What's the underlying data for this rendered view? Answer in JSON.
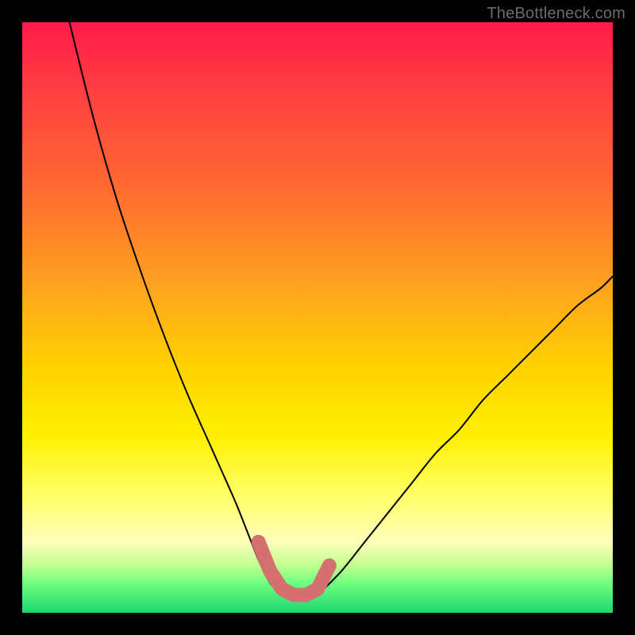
{
  "watermark": "TheBottleneck.com",
  "colors": {
    "curve": "#000000",
    "marker": "#d47070",
    "frame": "#000000"
  },
  "chart_data": {
    "type": "line",
    "title": "",
    "xlabel": "",
    "ylabel": "",
    "xlim": [
      0,
      100
    ],
    "ylim": [
      0,
      100
    ],
    "grid": false,
    "legend": false,
    "series": [
      {
        "name": "left-curve",
        "x": [
          8,
          12,
          16,
          20,
          24,
          28,
          32,
          36,
          38,
          40,
          42,
          44
        ],
        "y": [
          100,
          84,
          70,
          58,
          47,
          37,
          28,
          19,
          14,
          9,
          5,
          3
        ]
      },
      {
        "name": "right-curve",
        "x": [
          50,
          54,
          58,
          62,
          66,
          70,
          74,
          78,
          82,
          86,
          90,
          94,
          98,
          100
        ],
        "y": [
          3,
          7,
          12,
          17,
          22,
          27,
          31,
          36,
          40,
          44,
          48,
          52,
          55,
          57
        ]
      },
      {
        "name": "valley-marker",
        "x": [
          40,
          42,
          44,
          46,
          48,
          50,
          52
        ],
        "y": [
          12,
          7,
          4,
          3,
          3,
          4,
          8
        ]
      }
    ],
    "annotations": []
  }
}
